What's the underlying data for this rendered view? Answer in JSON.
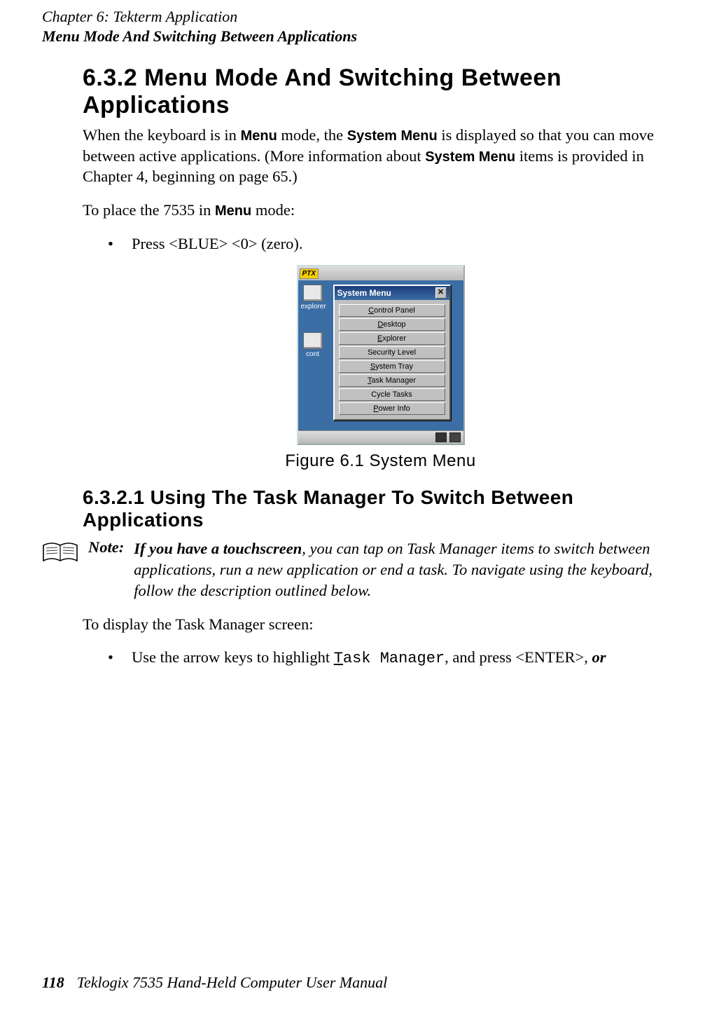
{
  "header": {
    "chapter_line": "Chapter 6: Tekterm Application",
    "section_line": "Menu Mode And Switching Between Applications"
  },
  "h632": "6.3.2  Menu Mode And Switching Between Applications",
  "p1_a": "When the keyboard is in ",
  "p1_menu": "Menu",
  "p1_b": " mode, the ",
  "p1_sysmenu": "System Menu",
  "p1_c": " is displayed so that you can move between active applications. (More information about ",
  "p1_sysmenu2": "System Menu",
  "p1_d": " items is provided in Chapter 4, beginning on page 65.)",
  "p2_a": "To place the 7535 in ",
  "p2_menu": "Menu",
  "p2_b": " mode:",
  "bullet1": "Press <BLUE> <0> (zero).",
  "figure": {
    "caption": "Figure 6.1 System Menu",
    "taskbar_badge": "PTX",
    "desk_icons": {
      "explorer": "explorer",
      "cont": "cont"
    },
    "window_title": "System Menu",
    "close_glyph": "✕",
    "items": [
      {
        "ul": "C",
        "rest": "ontrol Panel"
      },
      {
        "ul": "D",
        "rest": "esktop"
      },
      {
        "ul": "E",
        "rest": "xplorer"
      },
      {
        "ul": "",
        "rest": "Security Level"
      },
      {
        "ul": "S",
        "rest": "ystem Tray"
      },
      {
        "ul": "T",
        "rest": "ask Manager"
      },
      {
        "ul": "",
        "rest": "Cycle Tasks"
      },
      {
        "ul": "P",
        "rest": "ower Info"
      }
    ]
  },
  "h6321": "6.3.2.1  Using The Task Manager To Switch Between Applications",
  "note": {
    "label": "Note:",
    "bold_lead": "If you have a touchscreen",
    "rest": ", you can tap on Task Manager items to switch between applications, run a new application or end a task. To navigate using the keyboard, follow the description outlined below."
  },
  "p3": "To display the Task Manager screen:",
  "bullet2_a": "Use the arrow keys to highlight ",
  "bullet2_mono_ul": "T",
  "bullet2_mono_rest": "ask Manager",
  "bullet2_b": ", and press <ENTER>, ",
  "bullet2_or": "or",
  "footer": {
    "page": "118",
    "text": "Teklogix 7535 Hand-Held Computer User Manual"
  }
}
